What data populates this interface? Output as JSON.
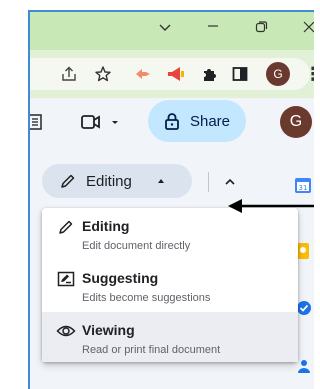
{
  "window": {
    "controls": {
      "minimize": "—",
      "maximize": "▢",
      "close": "✕",
      "dropdown": "⌄"
    }
  },
  "browser_toolbar": {
    "icons": [
      "share-page-icon",
      "bookmark-star-icon",
      "extension-icon",
      "megaphone-icon",
      "puzzle-icon",
      "sidebar-icon",
      "profile-avatar",
      "menu-icon"
    ],
    "profile_initial": "G",
    "menu_glyph": "⋮"
  },
  "doc_header": {
    "share_label": "Share",
    "account_initial": "G"
  },
  "mode_switcher": {
    "current_label": "Editing"
  },
  "mode_menu": {
    "items": [
      {
        "title": "Editing",
        "description": "Edit document directly",
        "icon": "pencil-icon"
      },
      {
        "title": "Suggesting",
        "description": "Edits become suggestions",
        "icon": "suggest-edit-icon"
      },
      {
        "title": "Viewing",
        "description": "Read or print final document",
        "icon": "eye-icon"
      }
    ],
    "selected": "Viewing"
  },
  "colors": {
    "titlebar": "#c8e8b5",
    "toolbar": "#e2f0d6",
    "share_bg": "#c2e7ff",
    "selected_item_bg": "#ebedf2",
    "frame_border": "#3c8dd6"
  }
}
